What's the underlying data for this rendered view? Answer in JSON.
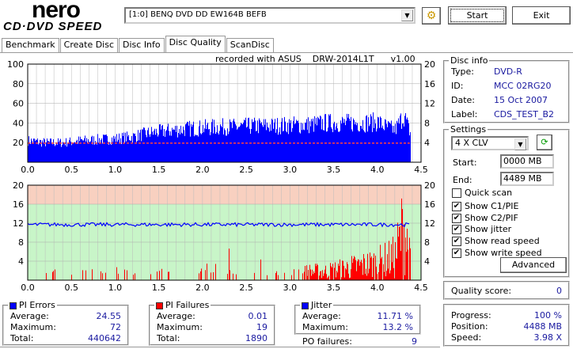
{
  "app": {
    "logo_top": "nero",
    "logo_bottom": "CD·DVD SPEED"
  },
  "toolbar": {
    "drive": "[1:0]  BENQ DVD DD EW164B BEFB",
    "start": "Start",
    "exit": "Exit"
  },
  "tabs": [
    "Benchmark",
    "Create Disc",
    "Disc Info",
    "Disc Quality",
    "ScanDisc"
  ],
  "chart_header": "recorded with ASUS    DRW-2014L1T      v1.00",
  "disc_info": {
    "title": "Disc info",
    "type_l": "Type:",
    "type": "DVD-R",
    "id_l": "ID:",
    "id": "MCC 02RG20",
    "date_l": "Date:",
    "date": "15 Oct 2007",
    "label_l": "Label:",
    "label": "CDS_TEST_B2"
  },
  "settings": {
    "title": "Settings",
    "speed": "4 X CLV",
    "start_l": "Start:",
    "start": "0000 MB",
    "end_l": "End:",
    "end": "4489 MB",
    "checks": [
      {
        "label": "Quick scan",
        "checked": false
      },
      {
        "label": "Show C1/PIE",
        "checked": true
      },
      {
        "label": "Show C2/PIF",
        "checked": true
      },
      {
        "label": "Show jitter",
        "checked": true
      },
      {
        "label": "Show read speed",
        "checked": true
      },
      {
        "label": "Show write speed",
        "checked": true
      }
    ],
    "advanced": "Advanced"
  },
  "quality": {
    "label": "Quality score:",
    "value": "0"
  },
  "progress": {
    "progress_l": "Progress:",
    "progress": "100 %",
    "position_l": "Position:",
    "position": "4488 MB",
    "speed_l": "Speed:",
    "speed": "3.98 X"
  },
  "pi_errors": {
    "title": "PI Errors",
    "avg_l": "Average:",
    "avg": "24.55",
    "max_l": "Maximum:",
    "max": "72",
    "total_l": "Total:",
    "total": "440642",
    "color": "#0000ff"
  },
  "pi_failures": {
    "title": "PI Failures",
    "avg_l": "Average:",
    "avg": "0.01",
    "max_l": "Maximum:",
    "max": "19",
    "total_l": "Total:",
    "total": "1890",
    "color": "#ff0000"
  },
  "jitter": {
    "title": "Jitter",
    "avg_l": "Average:",
    "avg": "11.71 %",
    "max_l": "Maximum:",
    "max": "13.2 %",
    "po_l": "PO failures:",
    "po": "9",
    "color": "#0000ff"
  },
  "chart_data": [
    {
      "type": "bar",
      "title": "PI Errors",
      "x_ticks": [
        "0.0",
        "0.5",
        "1.0",
        "1.5",
        "2.0",
        "2.5",
        "3.0",
        "3.5",
        "4.0",
        "4.5"
      ],
      "xlim": [
        0,
        4.5
      ],
      "ylim": [
        0,
        100
      ],
      "y_ticks": [
        "20",
        "40",
        "60",
        "80",
        "100"
      ],
      "y2lim": [
        0,
        20
      ],
      "y2_ticks": [
        "4",
        "8",
        "12",
        "16",
        "20"
      ],
      "x": [
        0,
        0.2,
        0.4,
        0.6,
        0.8,
        1.0,
        1.2,
        1.4,
        1.6,
        1.8,
        2.0,
        2.2,
        2.4,
        2.6,
        2.8,
        3.0,
        3.2,
        3.4,
        3.6,
        3.8,
        4.0,
        4.1,
        4.2,
        4.3,
        4.38
      ],
      "values": [
        22,
        20,
        20,
        22,
        23,
        24,
        26,
        30,
        32,
        34,
        35,
        36,
        36,
        37,
        37,
        38,
        38,
        40,
        40,
        40,
        41,
        36,
        33,
        48,
        28
      ],
      "read_speed": 3.9
    },
    {
      "type": "bar",
      "title": "PI Failures",
      "x_ticks": [
        "0.0",
        "0.5",
        "1.0",
        "1.5",
        "2.0",
        "2.5",
        "3.0",
        "3.5",
        "4.0",
        "4.5"
      ],
      "xlim": [
        0,
        4.5
      ],
      "ylim": [
        0,
        20
      ],
      "y_ticks": [
        "4",
        "8",
        "12",
        "16",
        "20"
      ],
      "y2_ticks": [
        "4",
        "8",
        "12",
        "16",
        "20"
      ],
      "x": [
        0,
        0.5,
        1.0,
        1.5,
        2.0,
        2.5,
        3.0,
        3.2,
        3.4,
        3.6,
        3.8,
        4.0,
        4.2,
        4.3,
        4.38
      ],
      "values": [
        1,
        1,
        1,
        1,
        1,
        1,
        1,
        3,
        3,
        4,
        5,
        6,
        8,
        19,
        5
      ],
      "jitter": 11.7
    }
  ]
}
